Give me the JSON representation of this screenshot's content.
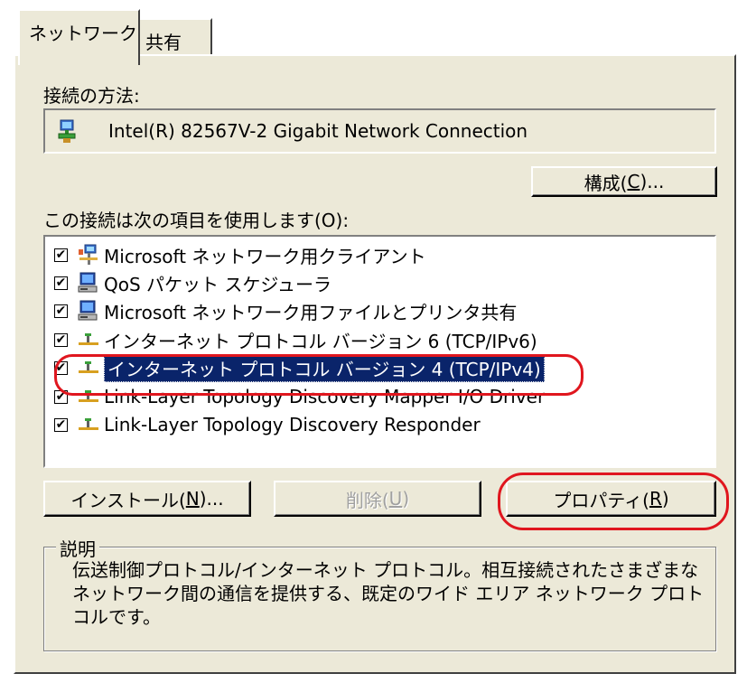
{
  "tabs": [
    {
      "label": "ネットワーク"
    },
    {
      "label": "共有"
    }
  ],
  "connect_using": {
    "label": "接続の方法:",
    "adapter": "Intel(R) 82567V-2 Gigabit Network Connection"
  },
  "configure_button": {
    "label": "構成(",
    "key": "C",
    "suffix": ")..."
  },
  "items_label": "この接続は次の項目を使用します(O):",
  "items": [
    {
      "label": "Microsoft ネットワーク用クライアント",
      "checked": true,
      "icon": "network-client-icon"
    },
    {
      "label": "QoS パケット スケジューラ",
      "checked": true,
      "icon": "computer-service-icon"
    },
    {
      "label": "Microsoft ネットワーク用ファイルとプリンタ共有",
      "checked": true,
      "icon": "computer-service-icon"
    },
    {
      "label": "インターネット プロトコル バージョン 6 (TCP/IPv6)",
      "checked": true,
      "icon": "protocol-icon"
    },
    {
      "label": "インターネット プロトコル バージョン 4 (TCP/IPv4)",
      "checked": true,
      "icon": "protocol-icon",
      "selected": true
    },
    {
      "label": "Link-Layer Topology Discovery Mapper I/O Driver",
      "checked": true,
      "icon": "protocol-icon"
    },
    {
      "label": "Link-Layer Topology Discovery Responder",
      "checked": true,
      "icon": "protocol-icon"
    }
  ],
  "buttons": {
    "install": {
      "label": "インストール(",
      "key": "N",
      "suffix": ")..."
    },
    "uninstall": {
      "label": "削除(",
      "key": "U",
      "suffix": ")"
    },
    "properties": {
      "label": "プロパティ(",
      "key": "R",
      "suffix": ")"
    }
  },
  "description": {
    "legend": "説明",
    "text": "伝送制御プロトコル/インターネット プロトコル。相互接続されたさまざまなネットワーク間の通信を提供する、既定のワイド エリア ネットワーク プロトコルです。"
  },
  "colors": {
    "dialog_bg": "#ece9d8",
    "selection_bg": "#0a246a",
    "highlight_ring": "#e0161e"
  }
}
